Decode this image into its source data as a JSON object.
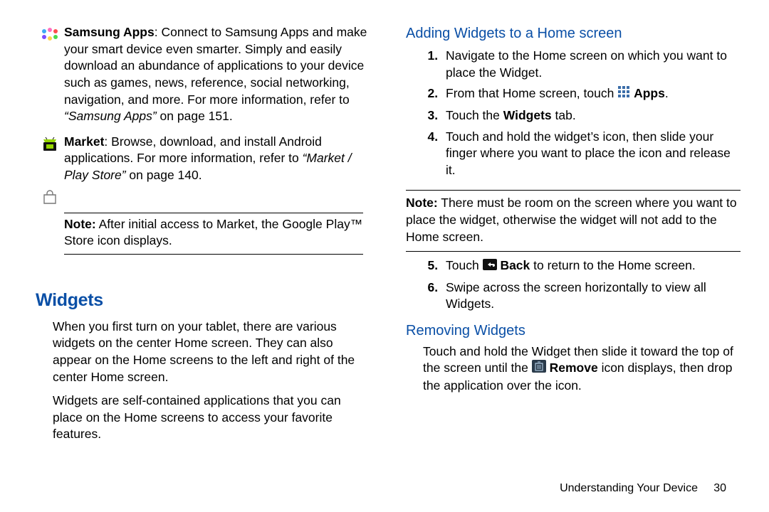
{
  "left": {
    "samsung_apps": {
      "label": "Samsung Apps",
      "text1": ": Connect to Samsung Apps and make your smart device even smarter. Simply and easily download an abundance of applications to your device such as games, news, reference, social networking, navigation, and more. For more information, refer to ",
      "ref": "“Samsung Apps”",
      "text2": " on page 151."
    },
    "market": {
      "label": "Market",
      "text1": ": Browse, download, and install Android applications. For more information, refer to ",
      "ref": "“Market / Play Store”",
      "text2": " on page 140."
    },
    "market_note": {
      "label": "Note:",
      "text": " After initial access to Market, the Google Play™ Store icon displays."
    },
    "widgets_heading": "Widgets",
    "widgets_p1": "When you first turn on your tablet, there are various widgets on the center Home screen. They can also appear on the Home screens to the left and right of the center Home screen.",
    "widgets_p2": "Widgets are self-contained applications that you can place on the Home screens to access your favorite features."
  },
  "right": {
    "heading_add": "Adding Widgets to a Home screen",
    "steps_a": {
      "s1": "Navigate to the Home screen on which you want to place the Widget.",
      "s2_a": "From that Home screen, touch ",
      "s2_b": "Apps",
      "s2_c": ".",
      "s3_a": "Touch the ",
      "s3_b": "Widgets",
      "s3_c": " tab.",
      "s4": "Touch and hold the widget’s icon, then slide your finger where you want to place the icon and release it."
    },
    "note": {
      "label": "Note:",
      "text": " There must be room on the screen where you want to place the widget, otherwise the widget will not add to the Home screen."
    },
    "steps_b": {
      "s5_a": "Touch ",
      "s5_b": "Back",
      "s5_c": " to return to the Home screen.",
      "s6": "Swipe across the screen horizontally to view all Widgets."
    },
    "heading_remove": "Removing Widgets",
    "remove_p_a": "Touch and hold the Widget then slide it toward the top of the screen until the ",
    "remove_p_b": "Remove",
    "remove_p_c": " icon displays, then drop the application over the icon."
  },
  "footer": {
    "section": "Understanding Your Device",
    "page": "30"
  }
}
